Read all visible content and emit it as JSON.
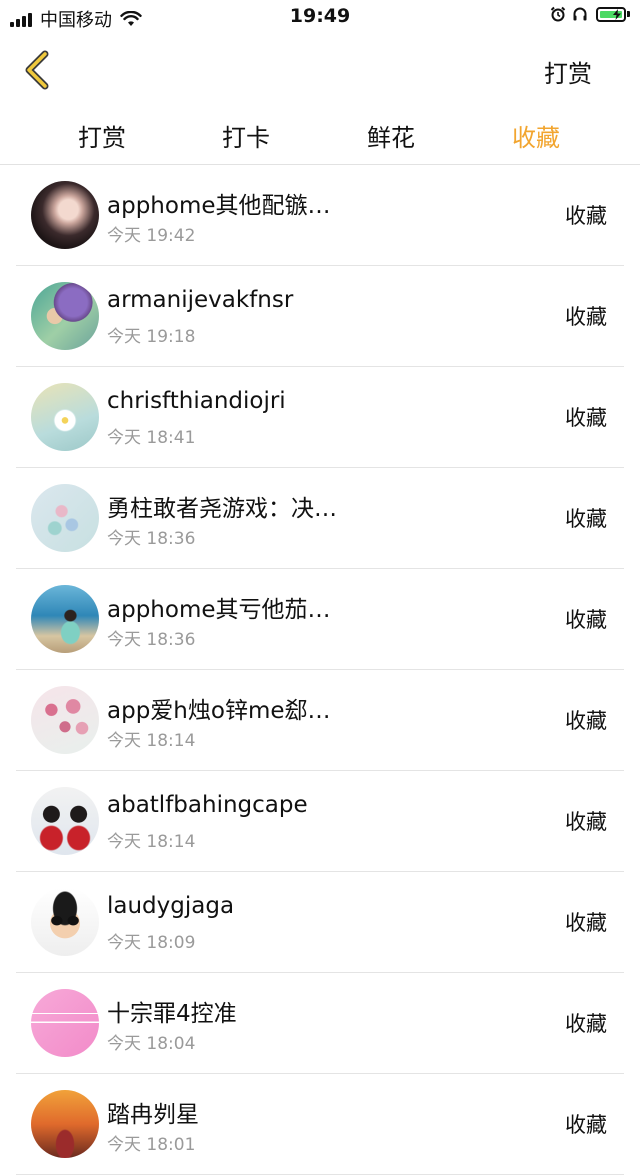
{
  "status_bar": {
    "carrier": "中国移动",
    "time": "19:49"
  },
  "nav": {
    "right_label": "打赏"
  },
  "tabs": [
    {
      "label": "打赏",
      "active": false
    },
    {
      "label": "打卡",
      "active": false
    },
    {
      "label": "鲜花",
      "active": false
    },
    {
      "label": "收藏",
      "active": true
    }
  ],
  "accent_color": "#f2a52f",
  "items": [
    {
      "name": "apphome其他配镞…",
      "time": "今天 19:42",
      "action": "收藏"
    },
    {
      "name": "armanijevakfnsr",
      "time": "今天 19:18",
      "action": "收藏"
    },
    {
      "name": "chrisfthiandiojri",
      "time": "今天 18:41",
      "action": "收藏"
    },
    {
      "name": "勇柱敢者尧游戏：决…",
      "time": "今天 18:36",
      "action": "收藏"
    },
    {
      "name": "apphome其亏他茄…",
      "time": "今天 18:36",
      "action": "收藏"
    },
    {
      "name": "app爱h烛o锌me郄…",
      "time": "今天 18:14",
      "action": "收藏"
    },
    {
      "name": "abatlfbahingcape",
      "time": "今天 18:14",
      "action": "收藏"
    },
    {
      "name": "laudygjaga",
      "time": "今天 18:09",
      "action": "收藏"
    },
    {
      "name": "十宗罪4控准",
      "time": "今天 18:04",
      "action": "收藏"
    },
    {
      "name": "踏冉刿星",
      "time": "今天 18:01",
      "action": "收藏"
    }
  ]
}
